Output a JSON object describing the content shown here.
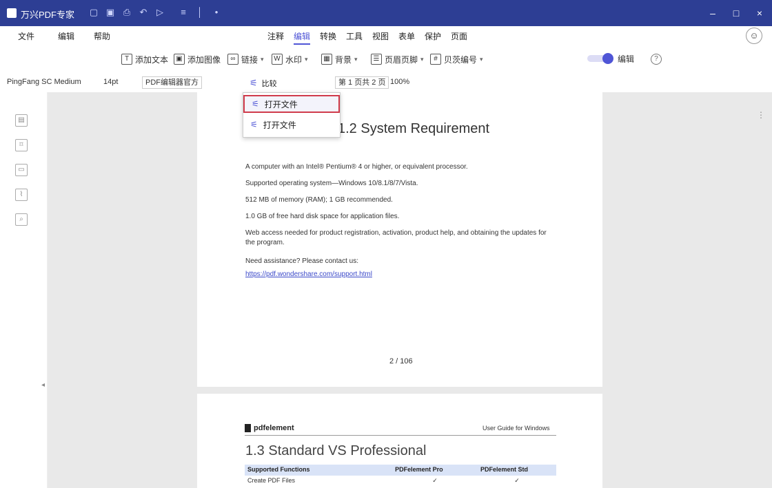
{
  "titlebar": {
    "app_name": "万兴PDF专家",
    "window_controls": {
      "minimize": "–",
      "maximize": "□",
      "close": "×"
    }
  },
  "menubar": {
    "left_items": [
      "文件",
      "编辑",
      "帮助"
    ],
    "tabs": [
      "注释",
      "编辑",
      "转换",
      "工具",
      "视图",
      "表单",
      "保护",
      "页面"
    ],
    "active_tab": "编辑"
  },
  "toolbar": {
    "items": [
      {
        "label": "添加文本"
      },
      {
        "label": "添加图像"
      },
      {
        "label": "链接"
      },
      {
        "label": "水印"
      },
      {
        "label": "背景"
      },
      {
        "label": "页眉页脚"
      },
      {
        "label": "贝茨编号"
      }
    ],
    "toggle_label": "编辑"
  },
  "format_bar": {
    "font": "PingFang SC Medium",
    "size": "14pt",
    "style_box": "PDF编辑器官方",
    "compare_label": "比较",
    "page_info": "第 1 页共 2 页",
    "zoom": "100%"
  },
  "dropdown": {
    "items": [
      {
        "label": "打开文件",
        "selected": true
      },
      {
        "label": "打开文件"
      }
    ]
  },
  "page1": {
    "heading": "1.2 System Requirement",
    "bullets": [
      "A computer with an Intel® Pentium® 4 or higher, or equivalent processor.",
      "Supported operating system—Windows 10/8.1/8/7/Vista.",
      "512 MB of memory (RAM); 1 GB recommended.",
      "1.0 GB of free hard disk space for application files.",
      "Web access needed for product registration, activation, product help, and obtaining the updates for the program."
    ],
    "note": "Need assistance? Please contact us:",
    "link": "https://pdf.wondershare.com/support.html",
    "page_number": "2 / 106"
  },
  "page2": {
    "logo_text": "pdfelement",
    "guide_text": "User Guide for Windows",
    "heading": "1.3 Standard VS Professional",
    "table_headers": [
      "Supported Functions",
      "PDFelement Pro",
      "PDFelement Std"
    ],
    "table_rows": [
      [
        "Create PDF Files",
        "✓",
        "✓"
      ]
    ]
  },
  "colors": {
    "titlebar": "#2d3e94",
    "accent": "#4f55d6",
    "highlight_border": "#d03a4a"
  }
}
